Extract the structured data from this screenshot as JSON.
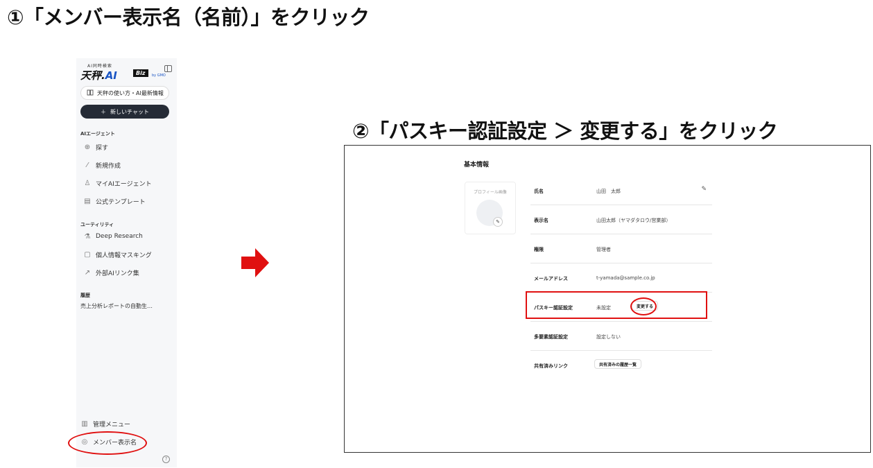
{
  "steps": {
    "step1": "①「メンバー表示名（名前）」をクリック",
    "step2": "②「パスキー認証設定 ＞ 変更する」をクリック"
  },
  "sidebar": {
    "logo_small": "AI同時検索",
    "logo_main_prefix": "天秤.",
    "logo_main_ai": "AI",
    "logo_biz": "Biz",
    "logo_gmo": "by GMO",
    "guide_button": "天秤の使い方・AI最新情報",
    "new_chat_button": "新しいチャット",
    "sections": {
      "agents": "AIエージェント",
      "utility": "ユーティリティ",
      "history": "履歴"
    },
    "agent_items": [
      {
        "label": "探す",
        "icon": "search-icon"
      },
      {
        "label": "新規作成",
        "icon": "magic-wand-icon"
      },
      {
        "label": "マイAIエージェント",
        "icon": "user-plus-icon"
      },
      {
        "label": "公式テンプレート",
        "icon": "template-icon"
      }
    ],
    "utility_items": [
      {
        "label": "Deep Research",
        "icon": "research-icon"
      },
      {
        "label": "個人情報マスキング",
        "icon": "mask-icon"
      },
      {
        "label": "外部AIリンク集",
        "icon": "external-link-icon"
      }
    ],
    "history_item": "売上分析レポートの自動生…",
    "admin_menu": "管理メニュー",
    "member_name": "メンバー表示名"
  },
  "panel": {
    "title": "基本情報",
    "avatar_label": "プロフィール画像",
    "rows": [
      {
        "label": "氏名",
        "value": "山田　太郎"
      },
      {
        "label": "表示名",
        "value": "山田太郎（ヤマダタロウ/営業部）"
      },
      {
        "label": "権限",
        "value": "管理者"
      },
      {
        "label": "メールアドレス",
        "value": "t-yamada@sample.co.jp"
      },
      {
        "label": "パスキー認証設定",
        "value": "未設定",
        "button": "変更する"
      },
      {
        "label": "多要素認証設定",
        "value": "設定しない"
      },
      {
        "label": "共有済みリンク",
        "button": "共有済みの履歴一覧"
      }
    ]
  },
  "colors": {
    "highlight": "#e01010",
    "accent_blue": "#1a55c4",
    "new_chat_bg": "#252b36"
  }
}
